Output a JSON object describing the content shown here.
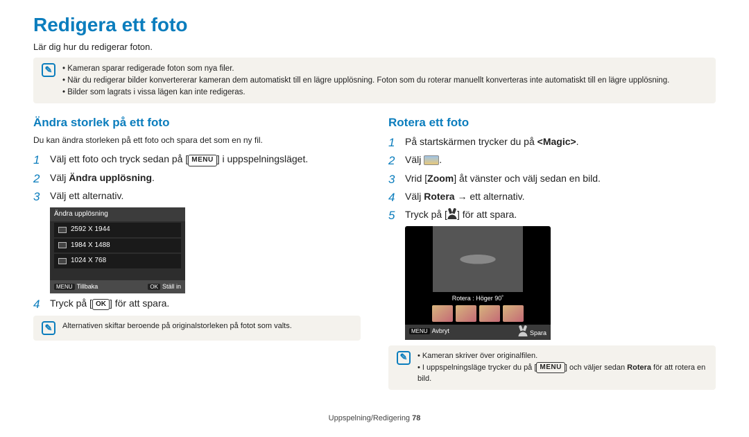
{
  "title": "Redigera ett foto",
  "intro": "Lär dig hur du redigerar foton.",
  "top_note": {
    "items": [
      "Kameran sparar redigerade foton som nya filer.",
      "När du redigerar bilder konvertererar kameran dem automatiskt till en lägre upplösning. Foton som du roterar manuellt konverteras inte automatiskt till en lägre upplösning.",
      "Bilder som lagrats i vissa lägen kan inte redigeras."
    ]
  },
  "left": {
    "heading": "Ändra storlek på ett foto",
    "sub": "Du kan ändra storleken på ett foto och spara det som en ny fil.",
    "step1_a": "Välj ett foto och tryck sedan på [",
    "step1_b": "] i uppspelningsläget.",
    "step2_a": "Välj ",
    "step2_b": "Ändra upplösning",
    "step2_c": ".",
    "step3": "Välj ett alternativ.",
    "screen": {
      "header": "Ändra upplösning",
      "opts": [
        "2592 X 1944",
        "1984 X 1488",
        "1024 X 768"
      ],
      "back_tag": "MENU",
      "back_txt": "Tillbaka",
      "set_tag": "OK",
      "set_txt": "Ställ in"
    },
    "step4_a": "Tryck på [",
    "step4_b": "] för att spara.",
    "note": "Alternativen skiftar beroende på originalstorleken på fotot som valts."
  },
  "right": {
    "heading": "Rotera ett foto",
    "step1_a": "På startskärmen trycker du på ",
    "step1_b": "<Magic>",
    "step1_c": ".",
    "step2": "Välj ",
    "step3_a": "Vrid [",
    "step3_b": "Zoom",
    "step3_c": "] åt vänster och välj sedan en bild.",
    "step4_a": "Välj ",
    "step4_b": "Rotera",
    "step4_c": " → ett alternativ.",
    "step5_a": "Tryck på [",
    "step5_b": "] för att spara.",
    "screen": {
      "caption": "Rotera : Höger 90˚",
      "back_tag": "MENU",
      "back_txt": "Avbryt",
      "save_txt": "Spara"
    },
    "note": {
      "items": [
        "Kameran skriver över originalfilen.",
        "I uppspelningsläge trycker du på [MENU] och väljer sedan Rotera för att rotera en bild."
      ]
    }
  },
  "footer_a": "Uppspelning/Redigering  ",
  "footer_b": "78",
  "icons": {
    "menu": "MENU",
    "ok": "OK"
  }
}
